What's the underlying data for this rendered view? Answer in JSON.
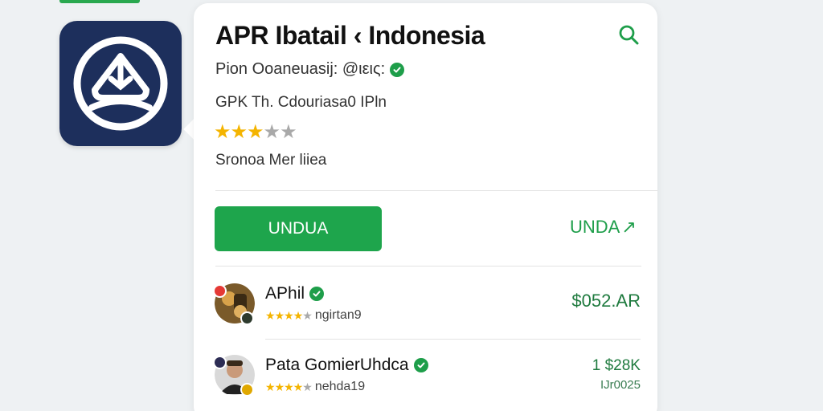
{
  "app": {
    "title": "APR Ibatail ‹ Indonesia",
    "developer": "Pion Ooaneuasij: @ιεις:",
    "version": "GPK Th. Cdouriasa0 IPln",
    "rating": {
      "filled": 3,
      "total": 5
    },
    "category": "Sronoa Mer liiea"
  },
  "actions": {
    "primary_label": "UNDUA",
    "secondary_label": "UNDA",
    "secondary_arrow": "↗"
  },
  "related": [
    {
      "name": "APhil",
      "verified": true,
      "stars_filled": 4,
      "stars_total": 5,
      "sub": "ngirtan9",
      "price": "$052.AR"
    },
    {
      "name": "Pata GomierUhdca",
      "verified": true,
      "stars_filled": 4,
      "stars_total": 5,
      "sub": "nehda19",
      "price": "1 $28K",
      "price_sub": "IJr0025"
    }
  ],
  "colors": {
    "accent_green": "#1ea54c",
    "star_gold": "#f4b400",
    "icon_bg": "#1d2f5c"
  },
  "icons": [
    "app-logo-icon",
    "search-icon",
    "verified-icon",
    "arrow-icon",
    "star-icon"
  ]
}
